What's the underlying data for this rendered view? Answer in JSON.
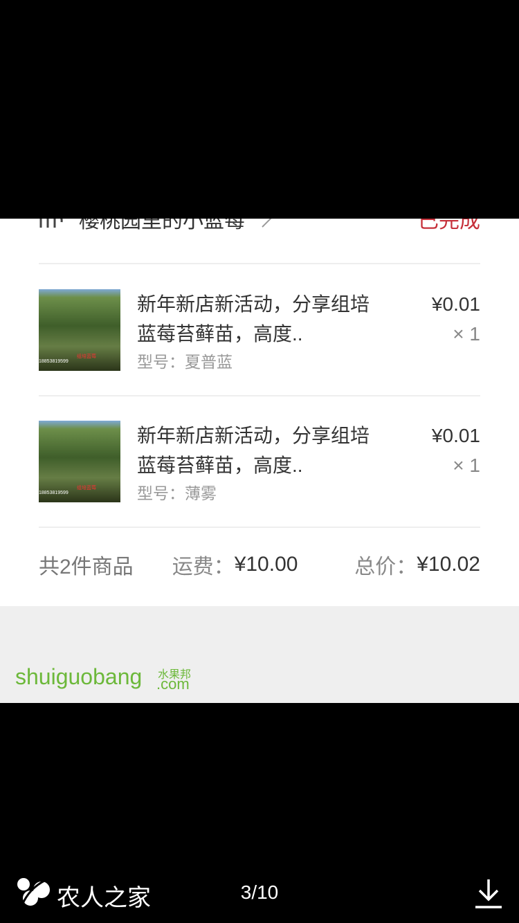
{
  "order": {
    "shop_name": "樱桃园里的小蓝莓",
    "status": "已完成",
    "items": [
      {
        "title_line1": "新年新店新活动，分享组培",
        "title_line2": "蓝莓苔藓苗，高度..",
        "spec": "型号：夏普蓝",
        "price": "¥0.01",
        "qty": "× 1"
      },
      {
        "title_line1": "新年新店新活动，分享组培",
        "title_line2": "蓝莓苔藓苗，高度..",
        "spec": "型号：薄雾",
        "price": "¥0.01",
        "qty": "× 1"
      }
    ],
    "summary": {
      "count": "共2件商品",
      "shipping_label": "运费：",
      "shipping_value": "¥10.00",
      "total_label": "总价：",
      "total_value": "¥10.02"
    }
  },
  "watermark": {
    "text": "shuiguobang",
    "sub": "水果邦",
    "com": ".com"
  },
  "viewer": {
    "site_name": "农人之家",
    "page_indicator": "3/10"
  },
  "icons": [
    "shop-icon",
    "chevron-right-icon",
    "site-logo-icon",
    "download-icon"
  ],
  "colors": {
    "status": "#c6303a",
    "watermark": "#6cb83a",
    "background": "#000000"
  }
}
